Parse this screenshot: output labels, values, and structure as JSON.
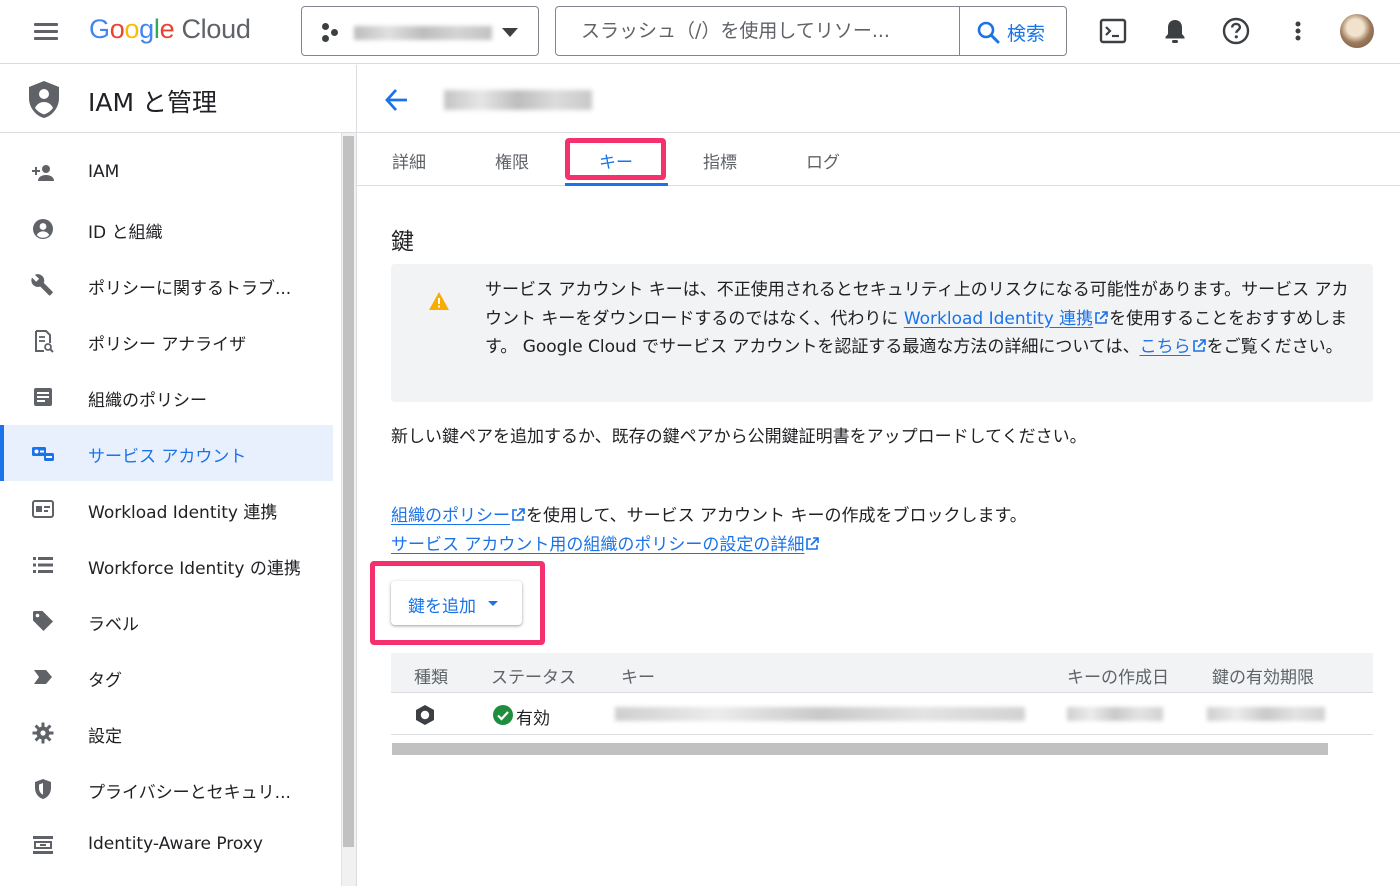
{
  "topbar": {
    "logo_google": "Google",
    "logo_cloud": "Cloud",
    "search_placeholder": "スラッシュ（/）を使用してリソー...",
    "search_button": "検索"
  },
  "nav": {
    "title": "IAM と管理",
    "items": [
      {
        "label": "IAM",
        "icon": "person-add-icon"
      },
      {
        "label": "ID と組織",
        "icon": "account-circle-icon"
      },
      {
        "label": "ポリシーに関するトラブ...",
        "icon": "wrench-icon"
      },
      {
        "label": "ポリシー アナライザ",
        "icon": "policy-doc-icon"
      },
      {
        "label": "組織のポリシー",
        "icon": "article-icon"
      },
      {
        "label": "サービス アカウント",
        "icon": "service-account-icon"
      },
      {
        "label": "Workload Identity 連携",
        "icon": "badge-icon"
      },
      {
        "label": "Workforce Identity の連携",
        "icon": "list-icon"
      },
      {
        "label": "ラベル",
        "icon": "tag-icon"
      },
      {
        "label": "タグ",
        "icon": "label-icon"
      },
      {
        "label": "設定",
        "icon": "gear-icon"
      },
      {
        "label": "プライバシーとセキュリ...",
        "icon": "shield-icon"
      },
      {
        "label": "Identity-Aware Proxy",
        "icon": "proxy-icon"
      }
    ],
    "active_index": 5
  },
  "tabs": [
    "詳細",
    "権限",
    "キー",
    "指標",
    "ログ"
  ],
  "active_tab": "キー",
  "section_title": "鍵",
  "warning": {
    "t1": "サービス アカウント キーは、不正使用されるとセキュリティ上のリスクになる可能性があります。サービス アカウント キーをダウンロードするのではなく、代わりに ",
    "link1": "Workload Identity 連携",
    "t2": "を使用することをおすすめします。 Google Cloud でサービス アカウントを認証する最適な方法の詳細については、",
    "link2": "こちら",
    "t3": "をご覧ください。"
  },
  "para1": "新しい鍵ペアを追加するか、既存の鍵ペアから公開鍵証明書をアップロードしてください。",
  "para2": {
    "link1": "組織のポリシー",
    "t1": "を使用して、サービス アカウント キーの作成をブロックします。",
    "link2": "サービス アカウント用の組織のポリシーの設定の詳細"
  },
  "add_key_label": "鍵を追加",
  "table": {
    "headers": [
      "種類",
      "ステータス",
      "キー",
      "キーの作成日",
      "鍵の有効期限"
    ],
    "rows": [
      {
        "type_icon": "key-type-icon",
        "status": "有効",
        "status_icon": "check-circle-icon"
      }
    ]
  },
  "colors": {
    "accent": "#1a73e8",
    "highlight": "#f4306d",
    "success": "#1e8e3e",
    "warning": "#f9ab00"
  }
}
